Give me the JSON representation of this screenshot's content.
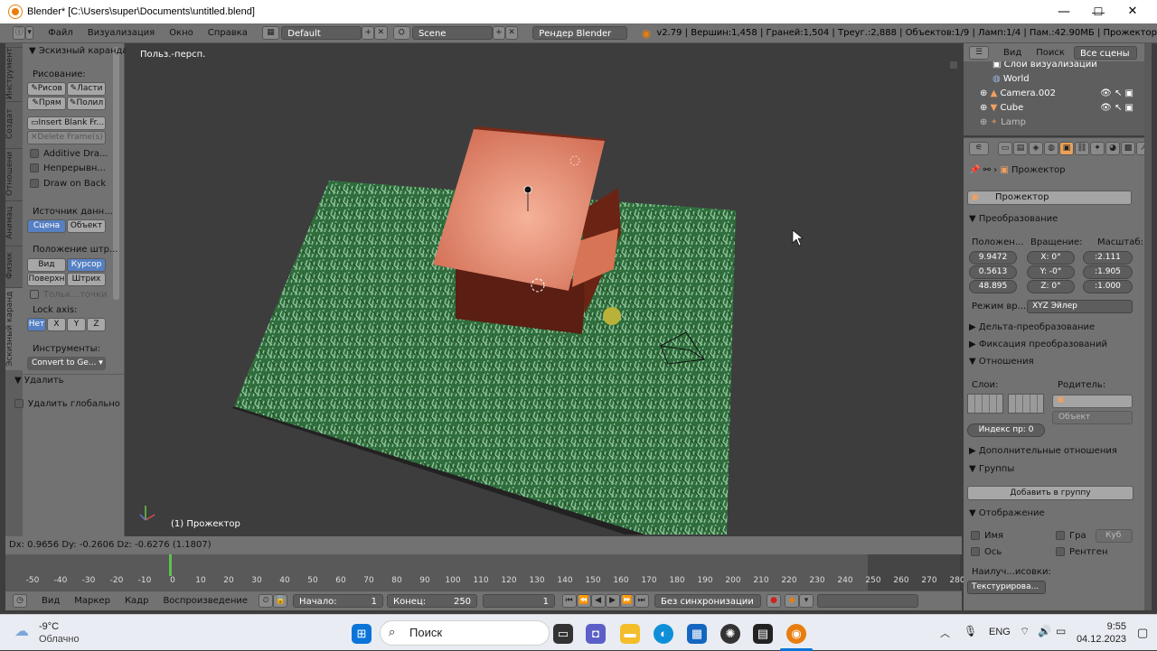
{
  "window": {
    "title": "Blender* [C:\\Users\\super\\Documents\\untitled.blend]",
    "controls": [
      "—",
      "☐",
      "✕"
    ]
  },
  "infobar": {
    "menus": [
      "Файл",
      "Визуализация",
      "Окно",
      "Справка"
    ],
    "layout": "Default",
    "scene": "Scene",
    "renderer": "Рендер Blender",
    "stats": "v2.79 | Вершин:1,458 | Граней:1,504 | Треуг.:2,888 | Объектов:1/9 | Ламп:1/4 | Пам.:42.90МБ | Прожектор"
  },
  "toolshelf": {
    "vtabs": [
      "Инструмент",
      "Создат",
      "Отношени",
      "Анимац",
      "Физик",
      "Эскизный каранд"
    ],
    "panel_title": "Эскизный карандаш",
    "draw_label": "Рисование:",
    "draw_buttons": [
      "Рисов",
      "Ласти",
      "Прям",
      "Полил"
    ],
    "insert_blank": "Insert Blank Fr...",
    "delete_frames": "Delete Frame(s)",
    "checks": [
      "Additive Dra...",
      "Непрерывн...",
      "Draw on Back"
    ],
    "source_label": "Источник данн...",
    "source_buttons": [
      "Сцена",
      "Объект"
    ],
    "stroke_label": "Положение штр...",
    "stroke_buttons": [
      "Вид",
      "Курсор",
      "Поверхн",
      "Штрих"
    ],
    "only_points": "Тольк...точки",
    "lock_label": "Lock axis:",
    "lock_buttons": [
      "Нет",
      "X",
      "Y",
      "Z"
    ],
    "tools_label": "Инструменты:",
    "convert": "Convert to Ge...",
    "delete_panel": "Удалить",
    "delete_global": "Удалить глобально"
  },
  "viewport": {
    "view_label": "Польз.-персп.",
    "object_label": "(1) Прожектор"
  },
  "statusline": "Dx: 0.9656   Dy: -0.2606   Dz: -0.6276 (1.1807)",
  "timeline": {
    "ticks": [
      "-50",
      "-40",
      "-30",
      "-20",
      "-10",
      "0",
      "10",
      "20",
      "30",
      "40",
      "50",
      "60",
      "70",
      "80",
      "90",
      "100",
      "110",
      "120",
      "130",
      "140",
      "150",
      "160",
      "170",
      "180",
      "190",
      "200",
      "210",
      "220",
      "230",
      "240",
      "250",
      "260",
      "270",
      "280"
    ],
    "current_frame_marker": 0,
    "menus": [
      "Вид",
      "Маркер",
      "Кадр",
      "Воспроизведение"
    ],
    "start_label": "Начало:",
    "start_value": "1",
    "end_label": "Конец:",
    "end_value": "250",
    "current": "1",
    "sync": "Без синхронизации"
  },
  "outliner": {
    "head": [
      "Вид",
      "Поиск",
      "Все сцены"
    ],
    "rows": [
      "Слои визуализации",
      "World",
      "Camera.002",
      "Cube",
      "Lamp"
    ]
  },
  "props": {
    "breadcrumb": "Прожектор",
    "object_name": "Прожектор",
    "transform_title": "Преобразование",
    "loc_label": "Положен...",
    "rot_label": "Вращение:",
    "scale_label": "Масштаб:",
    "loc": [
      "9.9472",
      "0.5613",
      "48.895"
    ],
    "rot": [
      "X:    0°",
      "Y:   -0°",
      "Z:    0°"
    ],
    "scale": [
      ":2.111",
      ":1.905",
      ":1.000"
    ],
    "rot_mode_label": "Режим вр...",
    "rot_mode": "XYZ Эйлер",
    "delta": "Дельта-преобразование",
    "lock": "Фиксация преобразований",
    "relations": "Отношения",
    "layers_label": "Слои:",
    "parent_label": "Родитель:",
    "parent_type": "Объект",
    "pass_index": "Индекс пр: 0",
    "extra_relations": "Дополнительные отношения",
    "groups": "Группы",
    "add_group": "Добавить в группу",
    "display": "Отображение",
    "disp_checks": [
      "Имя",
      "Гра",
      "Ось",
      "Рентген"
    ],
    "bounds_type": "Куб",
    "max_draw_label": "Наилуч...исовки:",
    "max_draw": "Текстурирова..."
  },
  "taskbar": {
    "temp": "-9°C",
    "weather": "Облачно",
    "search": "Поиск",
    "lang": "ENG",
    "time": "9:55",
    "date": "04.12.2023"
  },
  "colors": {
    "accent": "#5680c2",
    "panel": "#727272",
    "viewport": "#3d3d3d",
    "blender_orange": "#e87d0d"
  }
}
